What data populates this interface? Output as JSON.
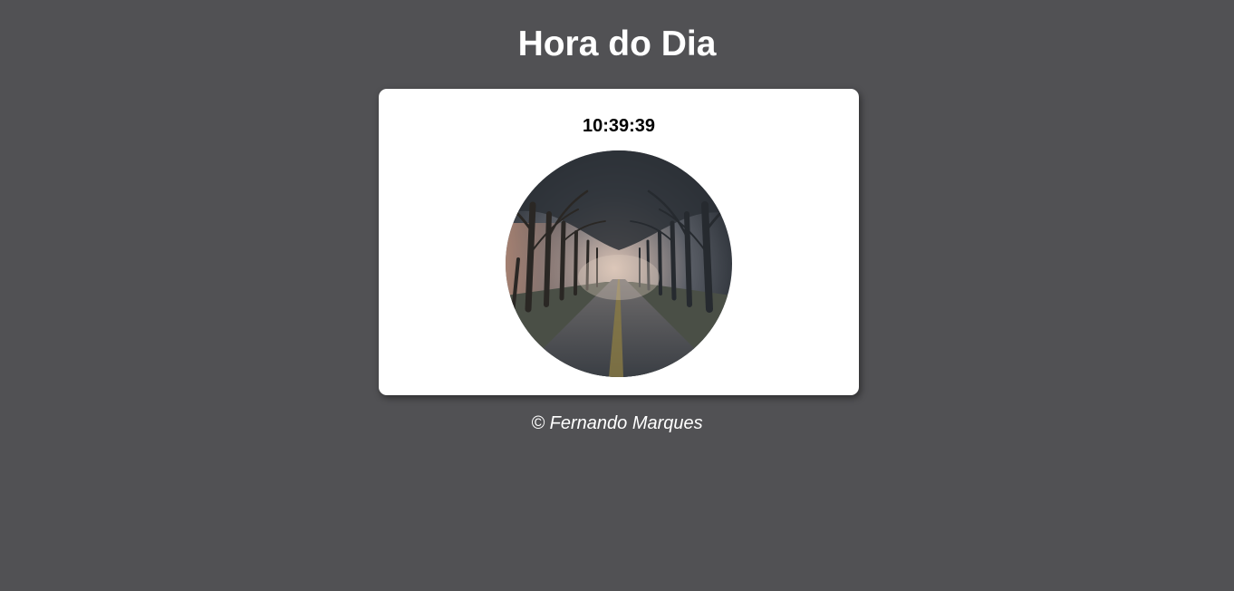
{
  "page": {
    "title": "Hora do Dia",
    "background_color": "#515154"
  },
  "clock": {
    "time": "10:39:39"
  },
  "photo": {
    "subject": "foggy tree-lined road at dawn"
  },
  "footer": {
    "text": "© Fernando Marques"
  }
}
